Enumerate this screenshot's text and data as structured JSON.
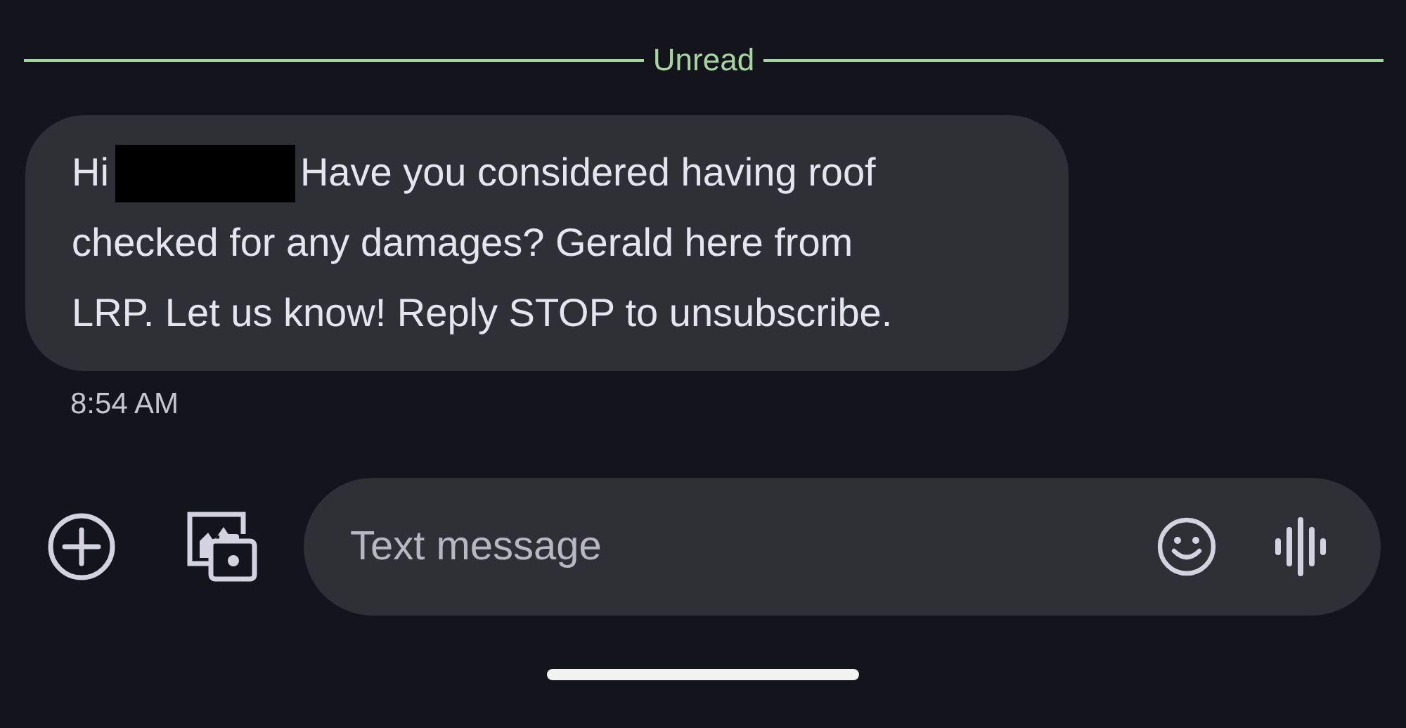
{
  "divider": {
    "label": "Unread"
  },
  "message": {
    "greeting": "Hi",
    "redacted": true,
    "lines": [
      "Have you considered having roof",
      "checked for any damages? Gerald here from",
      "LRP. Let us know! Reply STOP to unsubscribe."
    ],
    "time": "8:54 AM"
  },
  "composer": {
    "placeholder": "Text message"
  }
}
